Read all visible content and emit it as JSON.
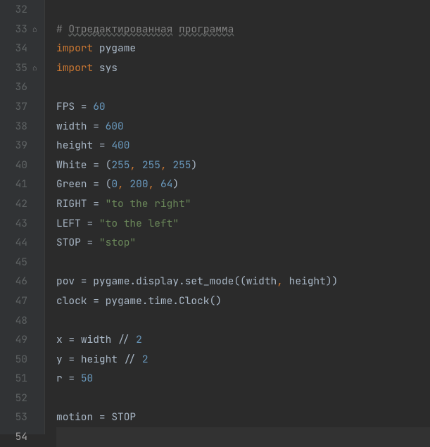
{
  "gutter": {
    "start": 32,
    "end": 54,
    "current": 54,
    "markers": [
      {
        "line": 33,
        "glyph": "⌂"
      },
      {
        "line": 35,
        "glyph": "⌂"
      }
    ]
  },
  "code": {
    "l32": "",
    "l33": {
      "hash": "# ",
      "w1": "Отредактированная",
      "sp": " ",
      "w2": "программа"
    },
    "l34": {
      "kw": "import",
      "sp": " ",
      "mod": "pygame"
    },
    "l35": {
      "kw": "import",
      "sp": " ",
      "mod": "sys"
    },
    "l36": "",
    "l37": {
      "name": "FPS",
      "eq": " = ",
      "val": "60"
    },
    "l38": {
      "name": "width",
      "eq": " = ",
      "val": "600"
    },
    "l39": {
      "name": "height",
      "eq": " = ",
      "val": "400"
    },
    "l40": {
      "name": "White",
      "eq": " = ",
      "op": "(",
      "v1": "255",
      "c1": ", ",
      "v2": "255",
      "c2": ", ",
      "v3": "255",
      "cp": ")"
    },
    "l41": {
      "name": "Green",
      "eq": " = ",
      "op": "(",
      "v1": "0",
      "c1": ", ",
      "v2": "200",
      "c2": ", ",
      "v3": "64",
      "cp": ")"
    },
    "l42": {
      "name": "RIGHT",
      "eq": " = ",
      "str": "\"to the right\""
    },
    "l43": {
      "name": "LEFT",
      "eq": " = ",
      "str": "\"to the left\""
    },
    "l44": {
      "name": "STOP",
      "eq": " = ",
      "str": "\"stop\""
    },
    "l45": "",
    "l46": {
      "lhs": "pov",
      "eq": " = ",
      "rhs1": "pygame.display.set_mode((width",
      "comma": ", ",
      "rhs2": "height))"
    },
    "l47": {
      "lhs": "clock",
      "eq": " = ",
      "rhs": "pygame.time.Clock()"
    },
    "l48": "",
    "l49": {
      "lhs": "x",
      "eq": " = ",
      "mid": "width // ",
      "val": "2"
    },
    "l50": {
      "lhs": "y",
      "eq": " = ",
      "mid": "height // ",
      "val": "2"
    },
    "l51": {
      "lhs": "r",
      "eq": " = ",
      "val": "50"
    },
    "l52": "",
    "l53": {
      "lhs": "motion",
      "eq": " = ",
      "rhs": "STOP"
    },
    "l54": ""
  }
}
